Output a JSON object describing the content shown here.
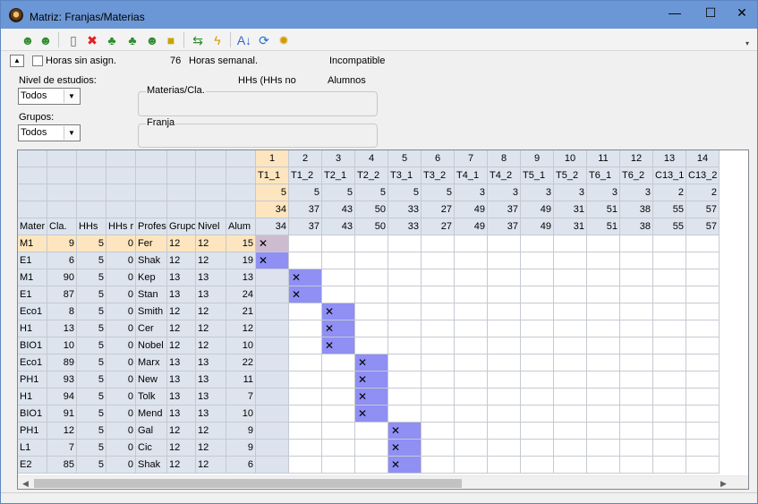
{
  "window": {
    "title": "Matriz: Franjas/Materias",
    "minimize": "—",
    "maximize": "☐",
    "close": "✕"
  },
  "toolbar": {
    "icons": [
      "people-green-icon",
      "people-arrow-icon",
      "new-doc-icon",
      "delete-red-x-icon",
      "tree-icon",
      "tree-split-icon",
      "people-list-icon",
      "lock-icon",
      "arrows-icon",
      "lightning-people-icon",
      "sort-az-icon",
      "refresh-icon",
      "settings-gear-icon"
    ],
    "overflow": "▾"
  },
  "panel": {
    "collapse": "▲",
    "horas_sin_asign": "Horas sin asign.",
    "horas_count": "76",
    "horas_semanal": "Horas semanal.",
    "incompatible": "Incompatible",
    "nivel_label": "Nivel de estudios:",
    "nivel_value": "Todos",
    "grupos_label": "Grupos:",
    "grupos_value": "Todos",
    "materias_cla": "Materias/Cla.",
    "hhs_no": "HHs (HHs no",
    "alumnos": "Alumnos",
    "franja": "Franja",
    "combo_arrow": "▼"
  },
  "grid": {
    "left_headers": [
      "Mater",
      "Cla.",
      "HHs",
      "HHs r",
      "Profes",
      "Grupo",
      "Nivel",
      "Alum"
    ],
    "columns": [
      {
        "num": "1",
        "code": "T1_1",
        "r2": "5",
        "r3": "34",
        "r4": "34"
      },
      {
        "num": "2",
        "code": "T1_2",
        "r2": "5",
        "r3": "37",
        "r4": "37"
      },
      {
        "num": "3",
        "code": "T2_1",
        "r2": "5",
        "r3": "43",
        "r4": "43"
      },
      {
        "num": "4",
        "code": "T2_2",
        "r2": "5",
        "r3": "50",
        "r4": "50"
      },
      {
        "num": "5",
        "code": "T3_1",
        "r2": "5",
        "r3": "33",
        "r4": "33"
      },
      {
        "num": "6",
        "code": "T3_2",
        "r2": "5",
        "r3": "27",
        "r4": "27"
      },
      {
        "num": "7",
        "code": "T4_1",
        "r2": "3",
        "r3": "49",
        "r4": "49"
      },
      {
        "num": "8",
        "code": "T4_2",
        "r2": "3",
        "r3": "37",
        "r4": "37"
      },
      {
        "num": "9",
        "code": "T5_1",
        "r2": "3",
        "r3": "49",
        "r4": "49"
      },
      {
        "num": "10",
        "code": "T5_2",
        "r2": "3",
        "r3": "31",
        "r4": "31"
      },
      {
        "num": "11",
        "code": "T6_1",
        "r2": "3",
        "r3": "51",
        "r4": "51"
      },
      {
        "num": "12",
        "code": "T6_2",
        "r2": "3",
        "r3": "38",
        "r4": "38"
      },
      {
        "num": "13",
        "code": "C13_1",
        "r2": "2",
        "r3": "55",
        "r4": "55"
      },
      {
        "num": "14",
        "code": "C13_2",
        "r2": "2",
        "r3": "57",
        "r4": "57"
      }
    ],
    "mark": "✕",
    "rows": [
      {
        "cells": [
          "M1",
          "9",
          "5",
          "0",
          "Fer",
          "12",
          "12",
          "15"
        ],
        "x": 1,
        "selected": true
      },
      {
        "cells": [
          "E1",
          "6",
          "5",
          "0",
          "Shak",
          "12",
          "12",
          "19"
        ],
        "x": 1
      },
      {
        "cells": [
          "M1",
          "90",
          "5",
          "0",
          "Kep",
          "13",
          "13",
          "13"
        ],
        "x": 2
      },
      {
        "cells": [
          "E1",
          "87",
          "5",
          "0",
          "Stan",
          "13",
          "13",
          "24"
        ],
        "x": 2
      },
      {
        "cells": [
          "Eco1",
          "8",
          "5",
          "0",
          "Smith",
          "12",
          "12",
          "21"
        ],
        "x": 3
      },
      {
        "cells": [
          "H1",
          "13",
          "5",
          "0",
          "Cer",
          "12",
          "12",
          "12"
        ],
        "x": 3
      },
      {
        "cells": [
          "BIO1",
          "10",
          "5",
          "0",
          "Nobel",
          "12",
          "12",
          "10"
        ],
        "x": 3
      },
      {
        "cells": [
          "Eco1",
          "89",
          "5",
          "0",
          "Marx",
          "13",
          "13",
          "22"
        ],
        "x": 4
      },
      {
        "cells": [
          "PH1",
          "93",
          "5",
          "0",
          "New",
          "13",
          "13",
          "11"
        ],
        "x": 4
      },
      {
        "cells": [
          "H1",
          "94",
          "5",
          "0",
          "Tolk",
          "13",
          "13",
          "7"
        ],
        "x": 4
      },
      {
        "cells": [
          "BIO1",
          "91",
          "5",
          "0",
          "Mend",
          "13",
          "13",
          "10"
        ],
        "x": 4
      },
      {
        "cells": [
          "PH1",
          "12",
          "5",
          "0",
          "Gal",
          "12",
          "12",
          "9"
        ],
        "x": 5
      },
      {
        "cells": [
          "L1",
          "7",
          "5",
          "0",
          "Cic",
          "12",
          "12",
          "9"
        ],
        "x": 5
      },
      {
        "cells": [
          "E2",
          "85",
          "5",
          "0",
          "Shak",
          "12",
          "12",
          "6"
        ],
        "x": 5
      }
    ]
  },
  "scroll": {
    "up": "▲",
    "down": "▼",
    "left": "◀",
    "right": "▶"
  },
  "colors": {
    "header_bg": "#dde4ee",
    "col1_bg": "#dce3ee",
    "selected_header": "#fde5bf",
    "mark_bg": "#8f8ff4",
    "mark_first": "#cdbbd0",
    "window_border": "#5b85c2"
  }
}
